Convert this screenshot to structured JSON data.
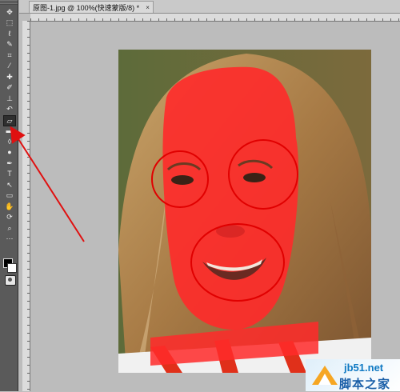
{
  "document": {
    "tab_title": "原图-1.jpg @ 100%(快速蒙版/8) *",
    "close_glyph": "×"
  },
  "toolbox": {
    "tools": [
      {
        "name": "move-tool",
        "glyph": "✥"
      },
      {
        "name": "marquee-tool",
        "glyph": "⬚"
      },
      {
        "name": "lasso-tool",
        "glyph": "ℓ"
      },
      {
        "name": "quick-selection-tool",
        "glyph": "✎"
      },
      {
        "name": "crop-tool",
        "glyph": "⌗"
      },
      {
        "name": "eyedropper-tool",
        "glyph": "⁄"
      },
      {
        "name": "healing-brush-tool",
        "glyph": "✚"
      },
      {
        "name": "brush-tool",
        "glyph": "✐"
      },
      {
        "name": "clone-stamp-tool",
        "glyph": "⊥"
      },
      {
        "name": "history-brush-tool",
        "glyph": "↶"
      },
      {
        "name": "eraser-tool",
        "glyph": "▱"
      },
      {
        "name": "gradient-tool",
        "glyph": "▬"
      },
      {
        "name": "blur-tool",
        "glyph": "◊"
      },
      {
        "name": "dodge-tool",
        "glyph": "●"
      },
      {
        "name": "pen-tool",
        "glyph": "✒"
      },
      {
        "name": "type-tool",
        "glyph": "T"
      },
      {
        "name": "path-selection-tool",
        "glyph": "↖"
      },
      {
        "name": "shape-tool",
        "glyph": "▭"
      },
      {
        "name": "hand-tool",
        "glyph": "✋"
      },
      {
        "name": "rotate-view-tool",
        "glyph": "⟳"
      },
      {
        "name": "zoom-tool",
        "glyph": "⌕"
      },
      {
        "name": "extra-tool",
        "glyph": "⋯"
      }
    ],
    "active_tool": "eraser-tool",
    "foreground_color": "#000000",
    "background_color": "#ffffff"
  },
  "overlay": {
    "mask_color": "#ff2a2a",
    "circle_color": "#e00000",
    "arrow_color": "#e01010"
  },
  "watermark": {
    "site": "jb51.net",
    "name": "脚本之家"
  }
}
